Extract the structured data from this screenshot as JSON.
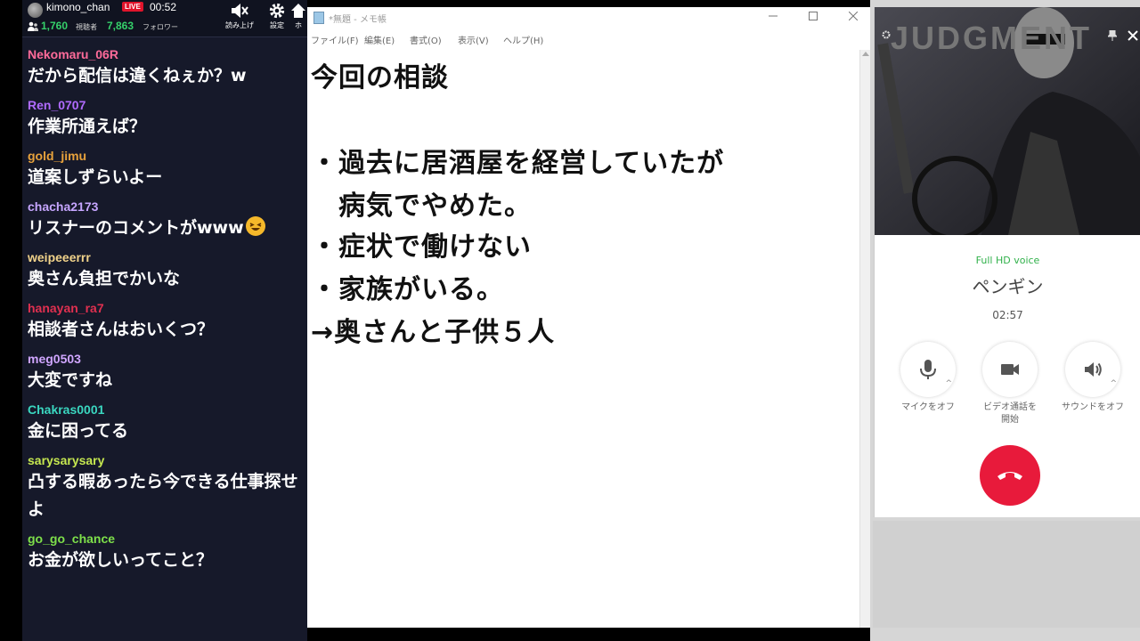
{
  "stream": {
    "username": "kimono_chan",
    "live_badge": "LIVE",
    "live_time": "00:52",
    "viewer_count": "1,760",
    "viewer_label": "視聴者",
    "follower_count": "7,863",
    "follower_label": "フォロワー",
    "buttons": [
      {
        "label": "読み上げ",
        "icon": "speaker-mute-icon"
      },
      {
        "label": "設定",
        "icon": "gear-icon"
      },
      {
        "label": "ホ",
        "icon": "home-icon"
      }
    ]
  },
  "chat": {
    "messages": [
      {
        "user": "Nekomaru_06R",
        "color": "#ff6b9a",
        "text": "だから配信は違くねぇか？w"
      },
      {
        "user": "Ren_0707",
        "color": "#b06bff",
        "text": "作業所通えば？"
      },
      {
        "user": "gold_jimu",
        "color": "#e8a23c",
        "text": "道案しずらいよー"
      },
      {
        "user": "chacha2173",
        "color": "#c6a6ff",
        "text": "リスナーのコメントがwww",
        "emoji": "laughing-emoji"
      },
      {
        "user": "weipeeerrr",
        "color": "#f0d28a",
        "text": "奥さん負担でかいな"
      },
      {
        "user": "hanayan_ra7",
        "color": "#e03050",
        "text": "相談者さんはおいくつ？"
      },
      {
        "user": "meg0503",
        "color": "#d0a6ff",
        "text": "大変ですね"
      },
      {
        "user": "Chakras0001",
        "color": "#3ad7c0",
        "text": "金に困ってる"
      },
      {
        "user": "sarysarysary",
        "color": "#c6e850",
        "text": "凸する暇あったら今できる仕事探せよ"
      },
      {
        "user": "go_go_chance",
        "color": "#7ee04a",
        "text": "お金が欲しいってこと？"
      }
    ]
  },
  "notepad": {
    "title": "*無題 - メモ帳",
    "menu": [
      "ファイル(F)",
      "編集(E)",
      "書式(O)",
      "表示(V)",
      "ヘルプ(H)"
    ],
    "lines": [
      "今回の相談",
      "",
      "・過去に居酒屋を経営していたが",
      "　病気でやめた。",
      "・症状で働けない",
      "・家族がいる。",
      "→奥さんと子供５人"
    ]
  },
  "call": {
    "video_title": "JUDGMENT",
    "hd_voice": "Full HD voice",
    "caller": "ペンギン",
    "duration": "02:57",
    "controls": [
      {
        "label": "マイクをオフ",
        "icon": "microphone-icon"
      },
      {
        "label": "ビデオ通話を開始",
        "icon": "video-camera-icon"
      },
      {
        "label": "サウンドをオフ",
        "icon": "speaker-icon"
      }
    ],
    "hangup_icon": "phone-hangup-icon",
    "accent_colors": {
      "hd_voice": "#30b14a",
      "hangup": "#e81a3b"
    }
  }
}
